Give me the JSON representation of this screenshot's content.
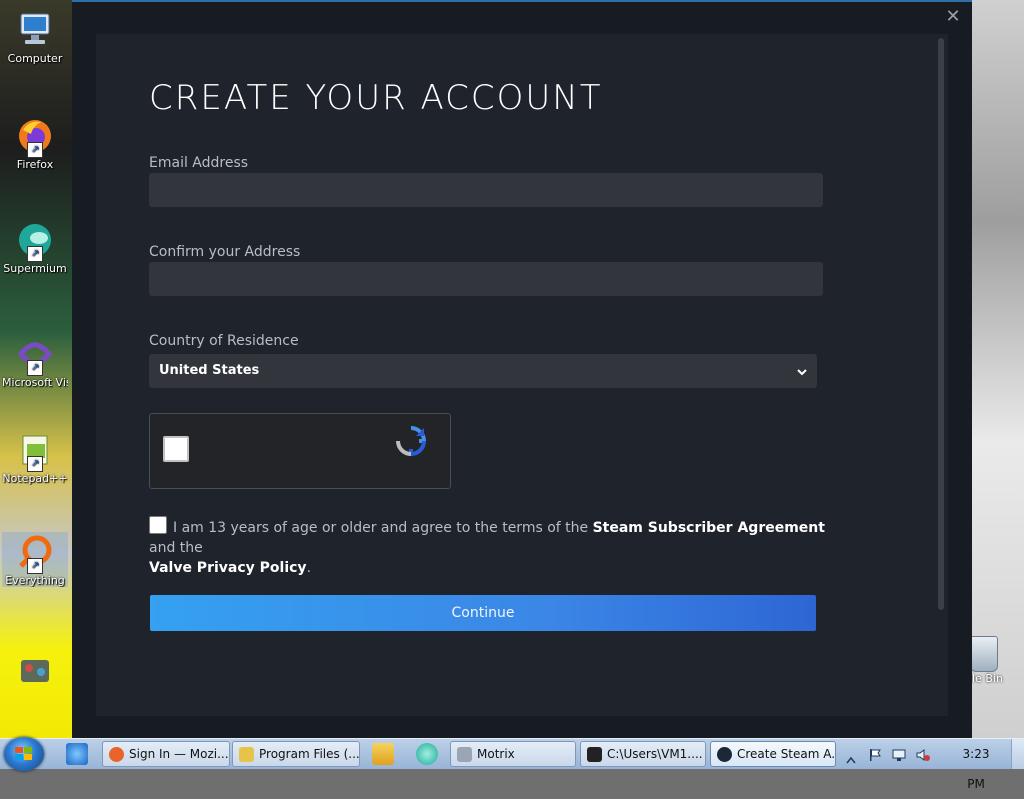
{
  "desktop": {
    "icons": [
      {
        "label": "Computer",
        "color": "#2d6fc2"
      },
      {
        "label": "Firefox",
        "color": "#f07a1a"
      },
      {
        "label": "Supermium",
        "color": "#1fa89a"
      },
      {
        "label": "Microsoft Visual Stud",
        "color": "#7a4bc4"
      },
      {
        "label": "Notepad++",
        "color": "#7fbf3a"
      },
      {
        "label": "Everything",
        "color": "#f06a10"
      }
    ],
    "recycle_label": "cle Bin"
  },
  "dialog": {
    "title": "CREATE YOUR ACCOUNT",
    "close_glyph": "✕",
    "email_label": "Email Address",
    "email_value": "",
    "confirm_label": "Confirm your Address",
    "confirm_value": "",
    "country_label": "Country of Residence",
    "country_value": "United States",
    "agree_text_1": "I am 13 years of age or older and agree to the terms of the",
    "ssa_link": "Steam Subscriber Agreement",
    "agree_text_2": "and the",
    "privacy_link": "Valve Privacy Policy",
    "agree_text_3": ".",
    "continue_label": "Continue"
  },
  "taskbar": {
    "buttons": [
      {
        "label": "Sign In — Mozi...",
        "icon_color": "#e8642a"
      },
      {
        "label": "Program Files (...",
        "icon_color": "#e7c34a"
      },
      {
        "label": "Motrix",
        "icon_color": "#9aa5b5"
      },
      {
        "label": "C:\\Users\\VM1....",
        "icon_color": "#222222"
      },
      {
        "label": "Create Steam A...",
        "icon_color": "#1b2838"
      }
    ],
    "clock": "3:23 PM"
  },
  "colors": {
    "accent": "#2f6fa6",
    "continue_start": "#35a1f0",
    "continue_end": "#2d66d4"
  }
}
